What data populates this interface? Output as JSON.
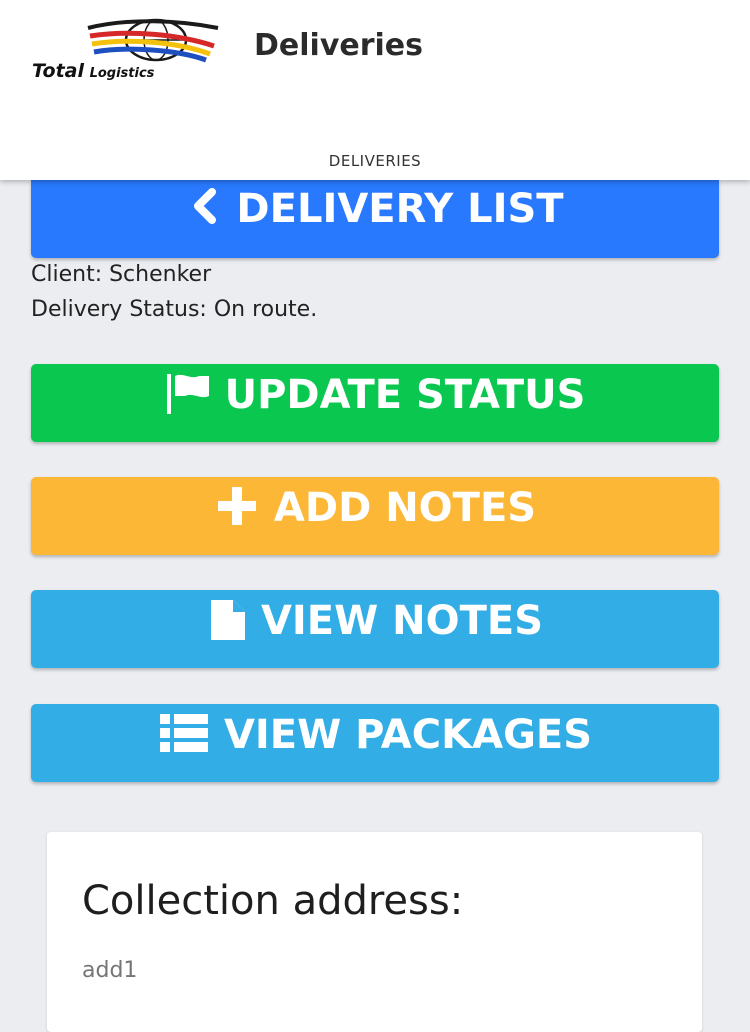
{
  "header": {
    "logo_text_big": "Total",
    "logo_text_small": "Logistics",
    "title": "Deliveries",
    "tab": "DELIVERIES"
  },
  "actions": {
    "delivery_list": "DELIVERY LIST",
    "update_status": "UPDATE STATUS",
    "add_notes": "ADD NOTES",
    "view_notes": "VIEW NOTES",
    "view_packages": "VIEW PACKAGES"
  },
  "info": {
    "client": "Client: Schenker",
    "status": "Delivery Status: On route."
  },
  "collection": {
    "title": "Collection address:",
    "value": "add1"
  },
  "colors": {
    "delivery_list": "#2979ff",
    "update_status": "#0ac74f",
    "add_notes": "#fdb737",
    "view_notes": "#32ade6",
    "view_packages": "#32ade6"
  },
  "icons": {
    "delivery_list": "chevron-left-icon",
    "update_status": "flag-icon",
    "add_notes": "plus-icon",
    "view_notes": "file-icon",
    "view_packages": "list-icon"
  }
}
